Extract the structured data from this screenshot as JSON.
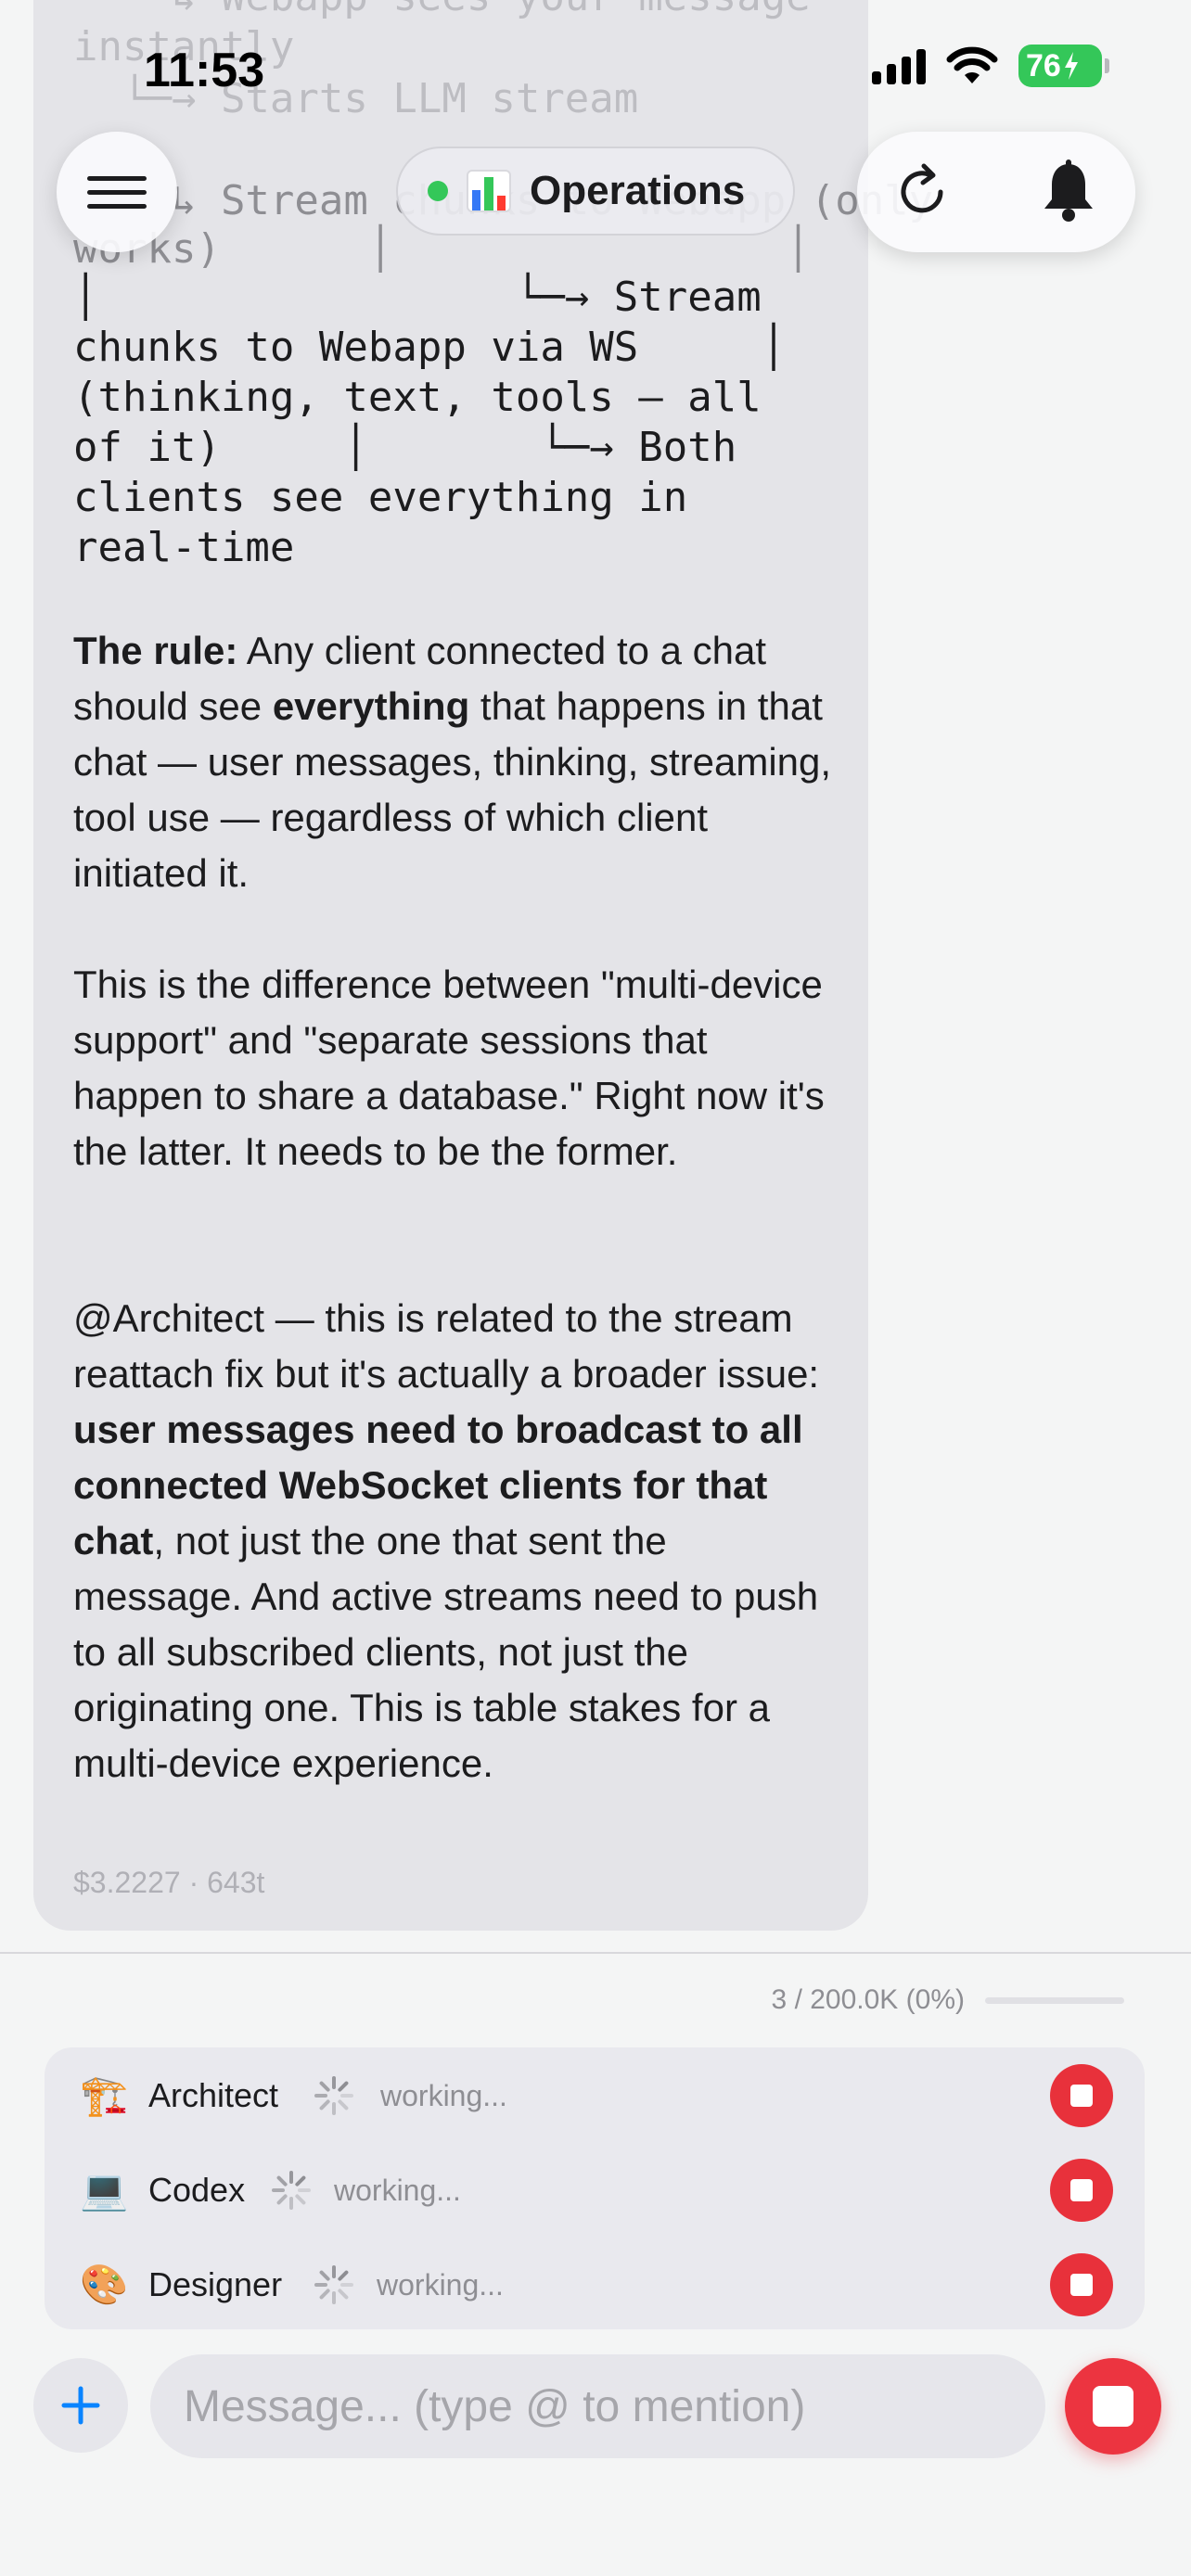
{
  "status_bar": {
    "time": "11:53",
    "battery": "76"
  },
  "header": {
    "channel_name": "Operations",
    "channel_status_color": "#34c759"
  },
  "message": {
    "code_lines": [
      "    ↳ Webapp sees your message",
      "instantly",
      "  └─→ Starts LLM stream",
      "",
      "    ↳ Stream chunks to Webapp (only",
      "works)      │                │",
      "│                 └─→ Stream",
      "chunks to Webapp via WS     │",
      "(thinking, text, tools — all",
      "of it)     │       └─→ Both",
      "clients see everything in",
      "real-time"
    ],
    "rule_lead": "The rule:",
    "rule_text_1": " Any client connected to a chat should see ",
    "rule_bold": "everything",
    "rule_text_2": " that happens in that chat — user messages, thinking, streaming, tool use — regardless of which client initiated it.",
    "paragraph_2": "This is the difference between \"multi-device support\" and \"separate sessions that happen to share a database.\" Right now it's the latter. It needs to be the former.",
    "p3_text_1": "@Architect — this is related to the stream reattach fix but it's actually a broader issue: ",
    "p3_bold": "user messages need to broadcast to all connected WebSocket clients for that chat",
    "p3_text_2": ", not just the one that sent the message. And active streams need to push to all subscribed clients, not just the originating one. This is table stakes for a multi-device experience.",
    "meta": "$3.2227 · 643t"
  },
  "context_usage": {
    "label": "3 / 200.0K (0%)",
    "fraction": 0.0
  },
  "agents": [
    {
      "emoji": "🏗️",
      "icon": "construction-crane-icon",
      "name": "Architect",
      "status": "working..."
    },
    {
      "emoji": "💻",
      "icon": "laptop-icon",
      "name": "Codex",
      "status": "working..."
    },
    {
      "emoji": "🎨",
      "icon": "palette-icon",
      "name": "Designer",
      "status": "working..."
    }
  ],
  "composer": {
    "placeholder": "Message... (type @ to mention)"
  },
  "colors": {
    "accent_blue": "#0a84ff",
    "stop_red": "#e8313b",
    "bubble_bg": "#e4e4e8"
  }
}
